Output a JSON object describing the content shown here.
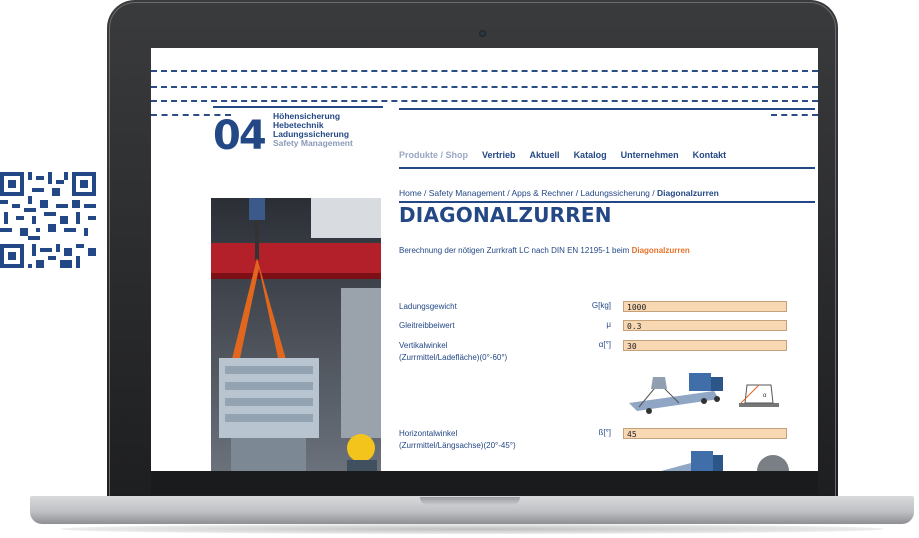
{
  "nav": {
    "items": [
      "Produkte / Shop",
      "Vertrieb",
      "Aktuell",
      "Katalog",
      "Unternehmen",
      "Kontakt"
    ],
    "active_index": 0
  },
  "logo": {
    "number": "04",
    "lines": [
      "Höhensicherung",
      "Hebetechnik",
      "Ladungssicherung",
      "Safety Management"
    ]
  },
  "breadcrumb": {
    "path": "Home / Safety Management / Apps & Rechner / Ladungssicherung / ",
    "current": "Diagonalzurren"
  },
  "page": {
    "title": "DIAGONALZURREN",
    "description_prefix": "Berechnung der nötigen Zurrkraft LC nach DIN EN 12195-1 beim ",
    "description_highlight": "Diagonalzurren"
  },
  "form": {
    "rows": [
      {
        "label": "Ladungsgewicht",
        "label2": "",
        "symbol": "G[kg]",
        "value": "1000"
      },
      {
        "label": "Gleitreibbeiwert",
        "label2": "",
        "symbol": "μ",
        "value": "0.3"
      },
      {
        "label": "Vertikalwinkel",
        "label2": "(Zurrmittel/Ladefläche)(0°-60°)",
        "symbol": "α[°]",
        "value": "30"
      },
      {
        "label": "Horizontalwinkel",
        "label2": "(Zurrmittel/Längsachse)(20°-45°)",
        "symbol": "ß[°]",
        "value": "45"
      }
    ]
  },
  "colors": {
    "brand_blue": "#244886",
    "accent_orange": "#e8722a",
    "field_fill": "#f8d8b2"
  },
  "icons": [
    "qr-code",
    "crane-photo",
    "truck-diagram"
  ]
}
